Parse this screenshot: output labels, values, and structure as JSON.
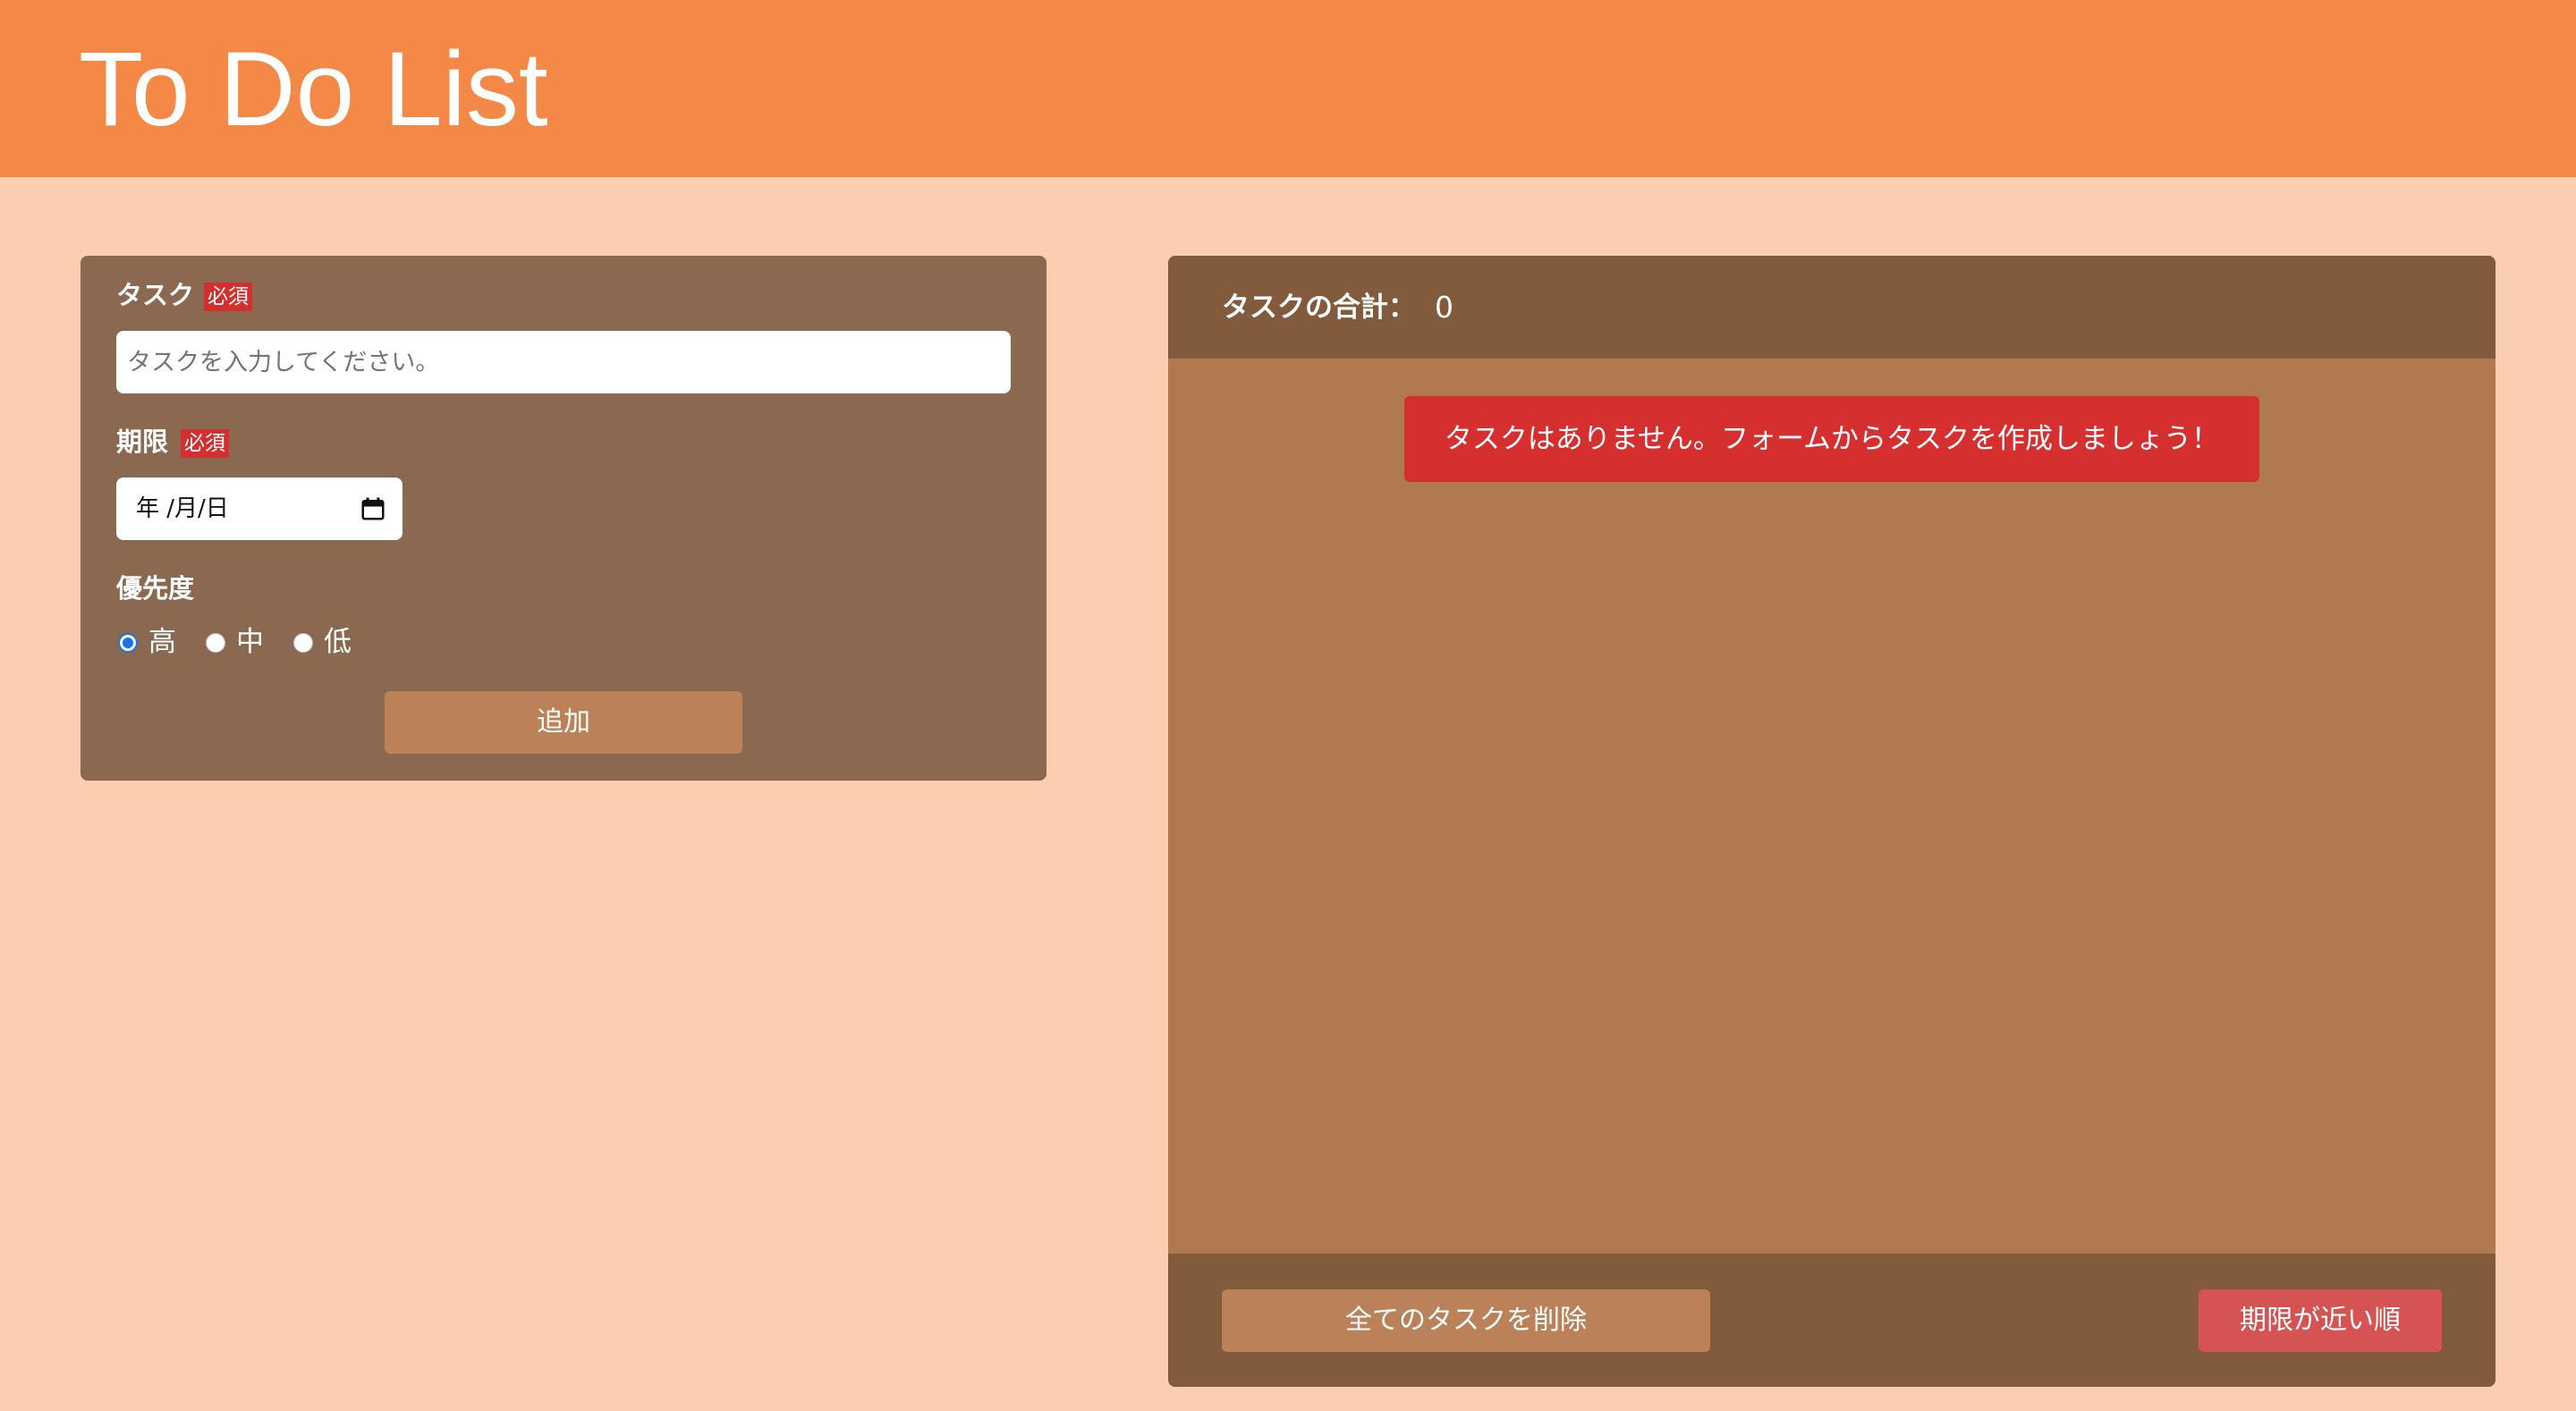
{
  "header": {
    "title": "To Do List",
    "background_color": "#f48947"
  },
  "form": {
    "task": {
      "label": "タスク",
      "required_badge": "必須",
      "placeholder": "タスクを入力してください。",
      "value": ""
    },
    "deadline": {
      "label": "期限",
      "required_badge": "必須",
      "display_value": "年 /月/日",
      "icon": "calendar-icon"
    },
    "priority": {
      "label": "優先度",
      "options": [
        {
          "label": "高",
          "checked": true
        },
        {
          "label": "中",
          "checked": false
        },
        {
          "label": "低",
          "checked": false
        }
      ]
    },
    "add_button_label": "追加"
  },
  "task_list": {
    "total_label": "タスクの合計：",
    "total_count": "0",
    "empty_message": "タスクはありません。フォームからタスクを作成しましょう！",
    "delete_all_label": "全てのタスクを削除",
    "sort_label": "期限が近い順"
  },
  "colors": {
    "page_background": "#fcceb1",
    "form_panel": "#8b6850",
    "list_panel": "#b1794f",
    "list_header_footer": "#825a3c",
    "button_primary": "#bb8158",
    "alert_red": "#d62f2f",
    "sort_button": "#d65354",
    "radio_checked": "#1a73e8"
  }
}
